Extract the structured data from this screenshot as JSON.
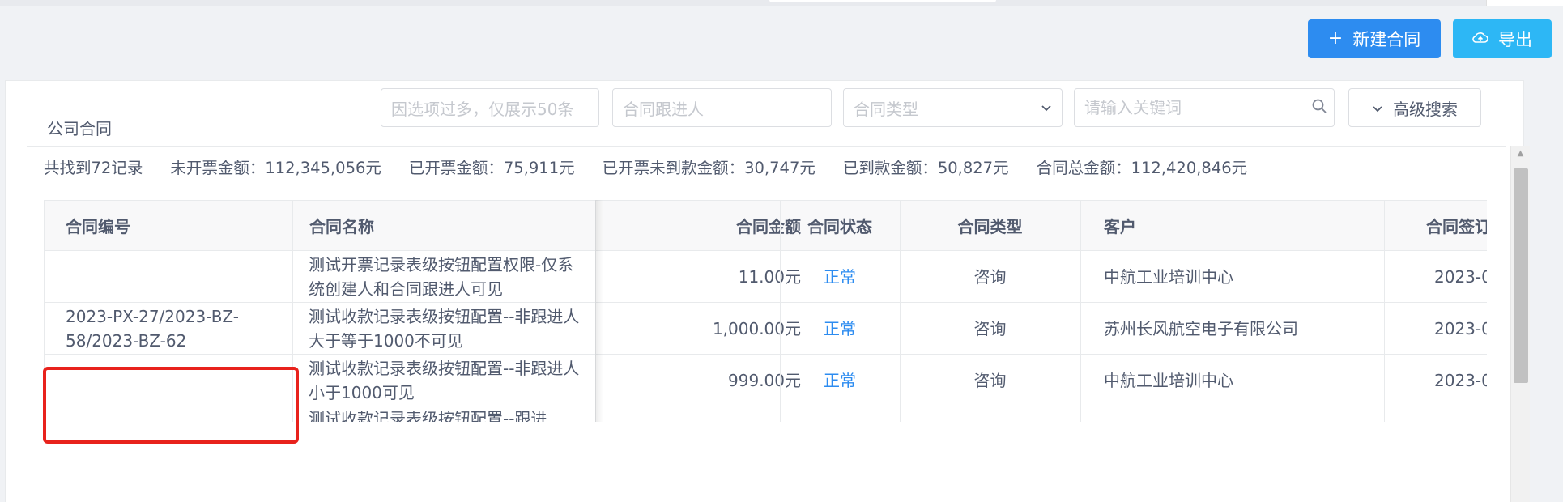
{
  "toolbar": {
    "new_label": "新建合同",
    "export_label": "导出"
  },
  "panel": {
    "title": "公司合同"
  },
  "filters": {
    "project_placeholder": "因选项过多，仅展示50条",
    "follower_placeholder": "合同跟进人",
    "type_placeholder": "合同类型",
    "keyword_placeholder": "请输入关键词",
    "advanced_label": "高级搜索"
  },
  "summary": {
    "found": "共找到72记录",
    "uninvoiced": "未开票金额：112,345,056元",
    "invoiced": "已开票金额：75,911元",
    "invoiced_unpaid": "已开票未到款金额：30,747元",
    "paid": "已到款金额：50,827元",
    "total": "合同总金额：112,420,846元"
  },
  "table": {
    "columns": [
      "合同编号",
      "合同名称",
      "合同金额",
      "合同状态",
      "合同类型",
      "客户",
      "合同签订"
    ],
    "rows": [
      {
        "no": "",
        "name": "测试开票记录表级按钮配置权限-仅系统创建人和合同跟进人可见",
        "amount": "11.00元",
        "status": "正常",
        "type": "咨询",
        "customer": "中航工业培训中心",
        "date": "2023-0"
      },
      {
        "no": "2023-PX-27/2023-BZ-58/2023-BZ-62",
        "name": "测试收款记录表级按钮配置--非跟进人大于等于1000不可见",
        "amount": "1,000.00元",
        "status": "正常",
        "type": "咨询",
        "customer": "苏州长风航空电子有限公司",
        "date": "2023-0"
      },
      {
        "no": "",
        "name": "测试收款记录表级按钮配置--非跟进人小于1000可见",
        "amount": "999.00元",
        "status": "正常",
        "type": "咨询",
        "customer": "中航工业培训中心",
        "date": "2023-0"
      },
      {
        "no": "",
        "name": "测试收款记录表级按钮配置--跟进",
        "amount": "",
        "status": "",
        "type": "",
        "customer": "",
        "date": ""
      }
    ]
  },
  "colors": {
    "primary": "#2d8cf0",
    "info": "#2db7f5",
    "highlight": "#e8221c"
  },
  "icons": {
    "new": "plus-icon",
    "export": "cloud-upload-icon",
    "search": "search-icon",
    "dropdown": "chevron-down-icon"
  }
}
